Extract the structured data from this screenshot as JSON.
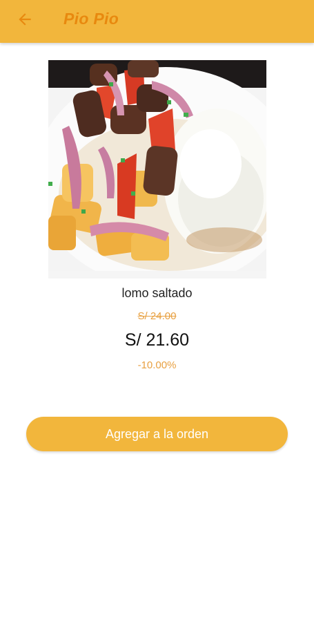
{
  "header": {
    "title": "Pio Pio",
    "back_icon": "arrow-left-icon",
    "background_color": "#f2b63c",
    "title_color": "#e8890f"
  },
  "product": {
    "image_icon": "dish-photo",
    "name": "lomo saltado",
    "original_price": "S/ 24.00",
    "price": "S/ 21.60",
    "discount": "-10.00%"
  },
  "actions": {
    "add_to_order_label": "Agregar a la orden",
    "accent_color": "#f2b63c"
  }
}
